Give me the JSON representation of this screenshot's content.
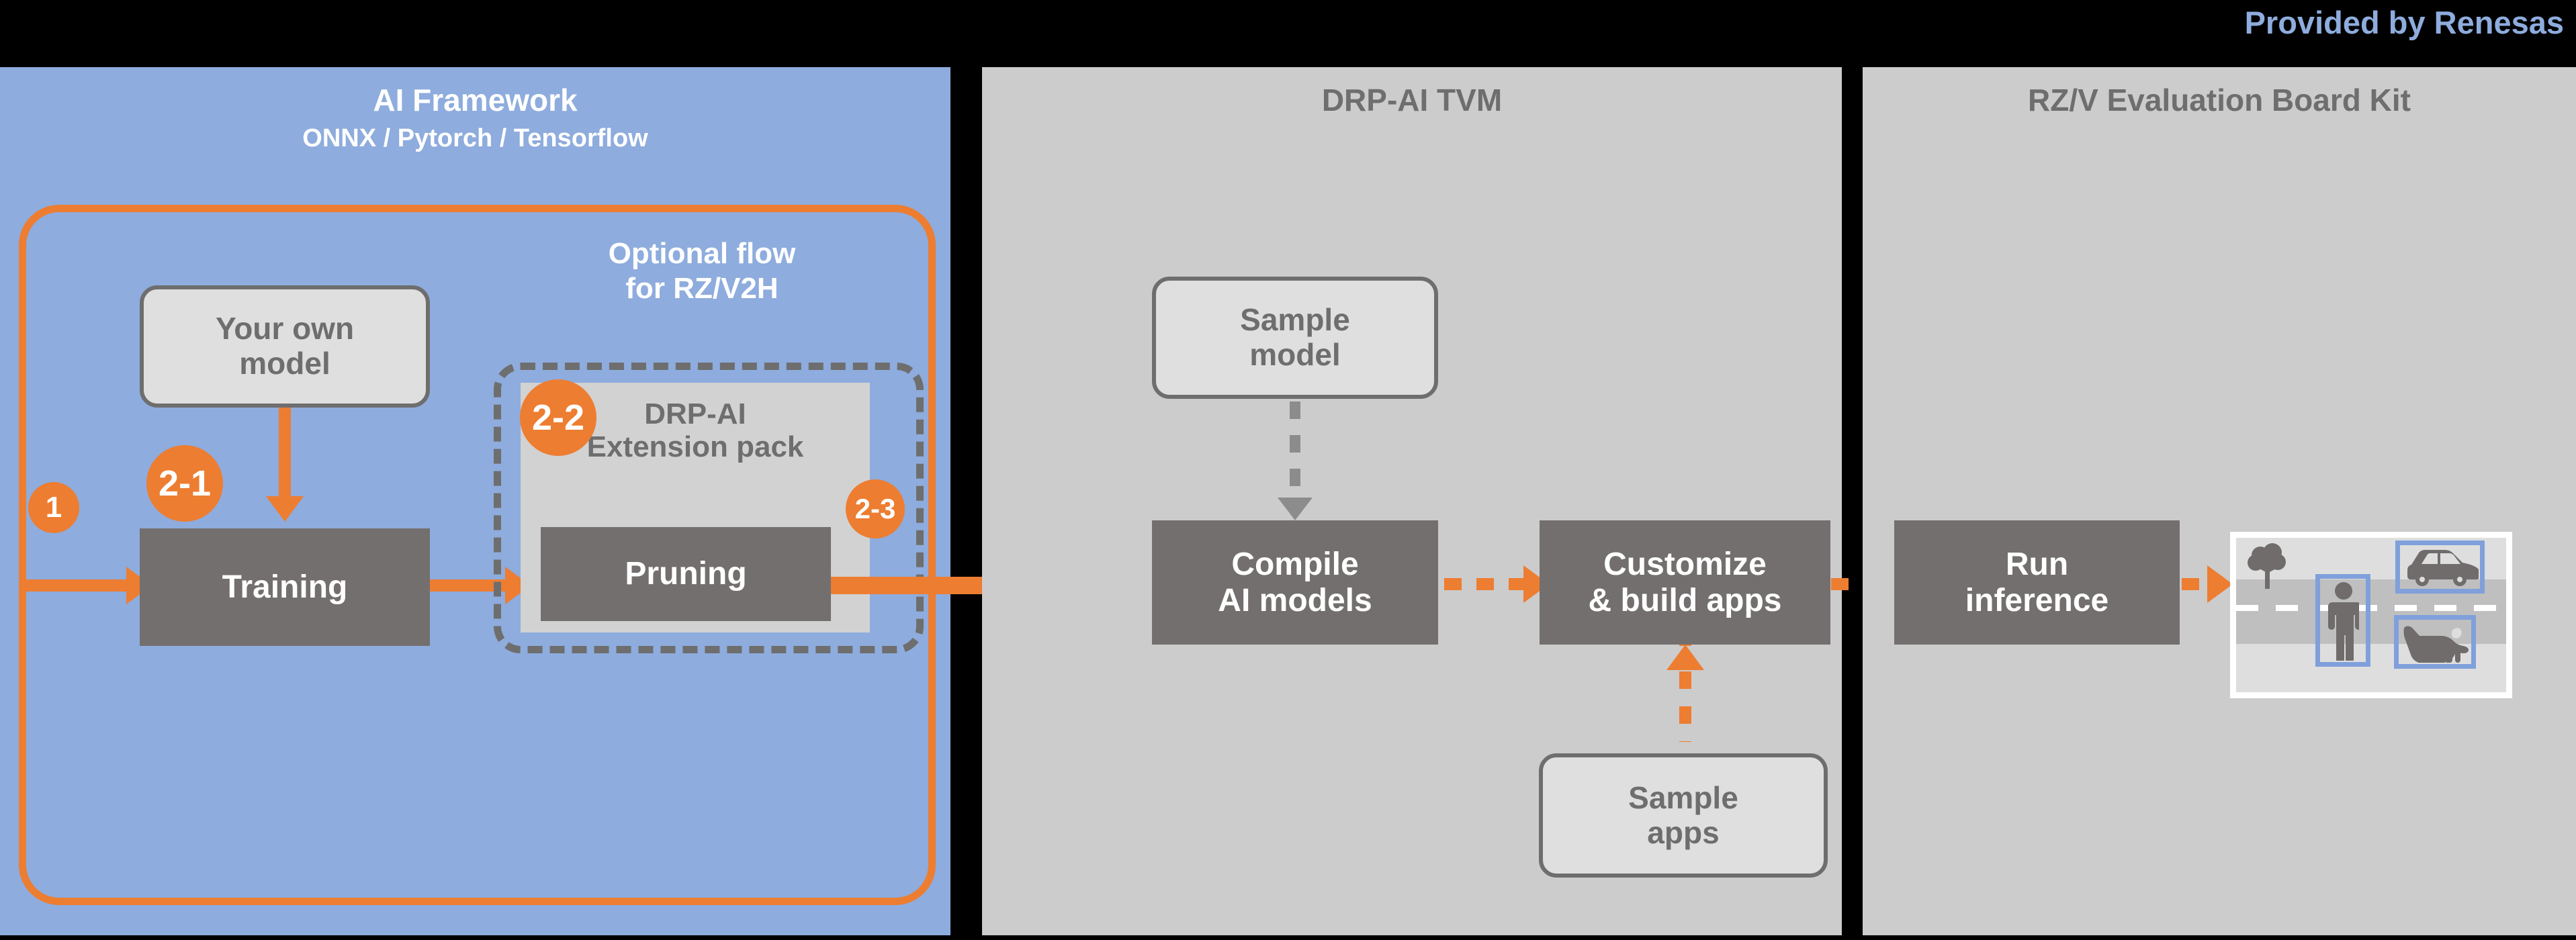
{
  "header": {
    "credit": "Provided by Renesas",
    "credit_color": "#8EACDD",
    "background": "#000000"
  },
  "panels": [
    {
      "id": "ai-framework",
      "title": "AI Framework",
      "subtitle": "ONNX / Pytorch / Tensorflow",
      "background": "#8EACDD",
      "title_color": "#FFFFFF"
    },
    {
      "id": "drp-ai-tvm",
      "title": "DRP-AI TVM",
      "background": "#CCCCCC",
      "title_color": "#6E6E6E"
    },
    {
      "id": "rzv-eval-board",
      "title": "RZ/V Evaluation Board Kit",
      "background": "#CCCCCC",
      "title_color": "#6E6E6E"
    }
  ],
  "ai_framework": {
    "optional_flow_label_line1": "Optional flow",
    "optional_flow_label_line2": "for RZ/V2H",
    "your_own_model": "Your own\nmodel",
    "training": "Training",
    "extension_pack_line1": "DRP-AI",
    "extension_pack_line2": "Extension pack",
    "pruning": "Pruning",
    "badges": {
      "step1": "1",
      "step2_1": "2-1",
      "step2_2": "2-2",
      "step2_3": "2-3"
    }
  },
  "drp_ai_tvm": {
    "sample_model": "Sample\nmodel",
    "compile_ai_models": "Compile\nAI models",
    "customize_build_apps": "Customize\n& build apps",
    "sample_apps": "Sample\napps"
  },
  "rzv_board": {
    "run_inference": "Run\ninference",
    "detection_objects": [
      "person",
      "car",
      "dog"
    ],
    "scene_objects": [
      "tree",
      "road"
    ]
  },
  "colors": {
    "accent_orange": "#ED7D31",
    "dark_box": "#736F6E",
    "light_box": "#DFDFDF",
    "outline_gray": "#6E6E6E",
    "panel_gray": "#CCCCCC",
    "panel_blue": "#8EACDD",
    "bbox_blue": "#7FA0DB"
  }
}
